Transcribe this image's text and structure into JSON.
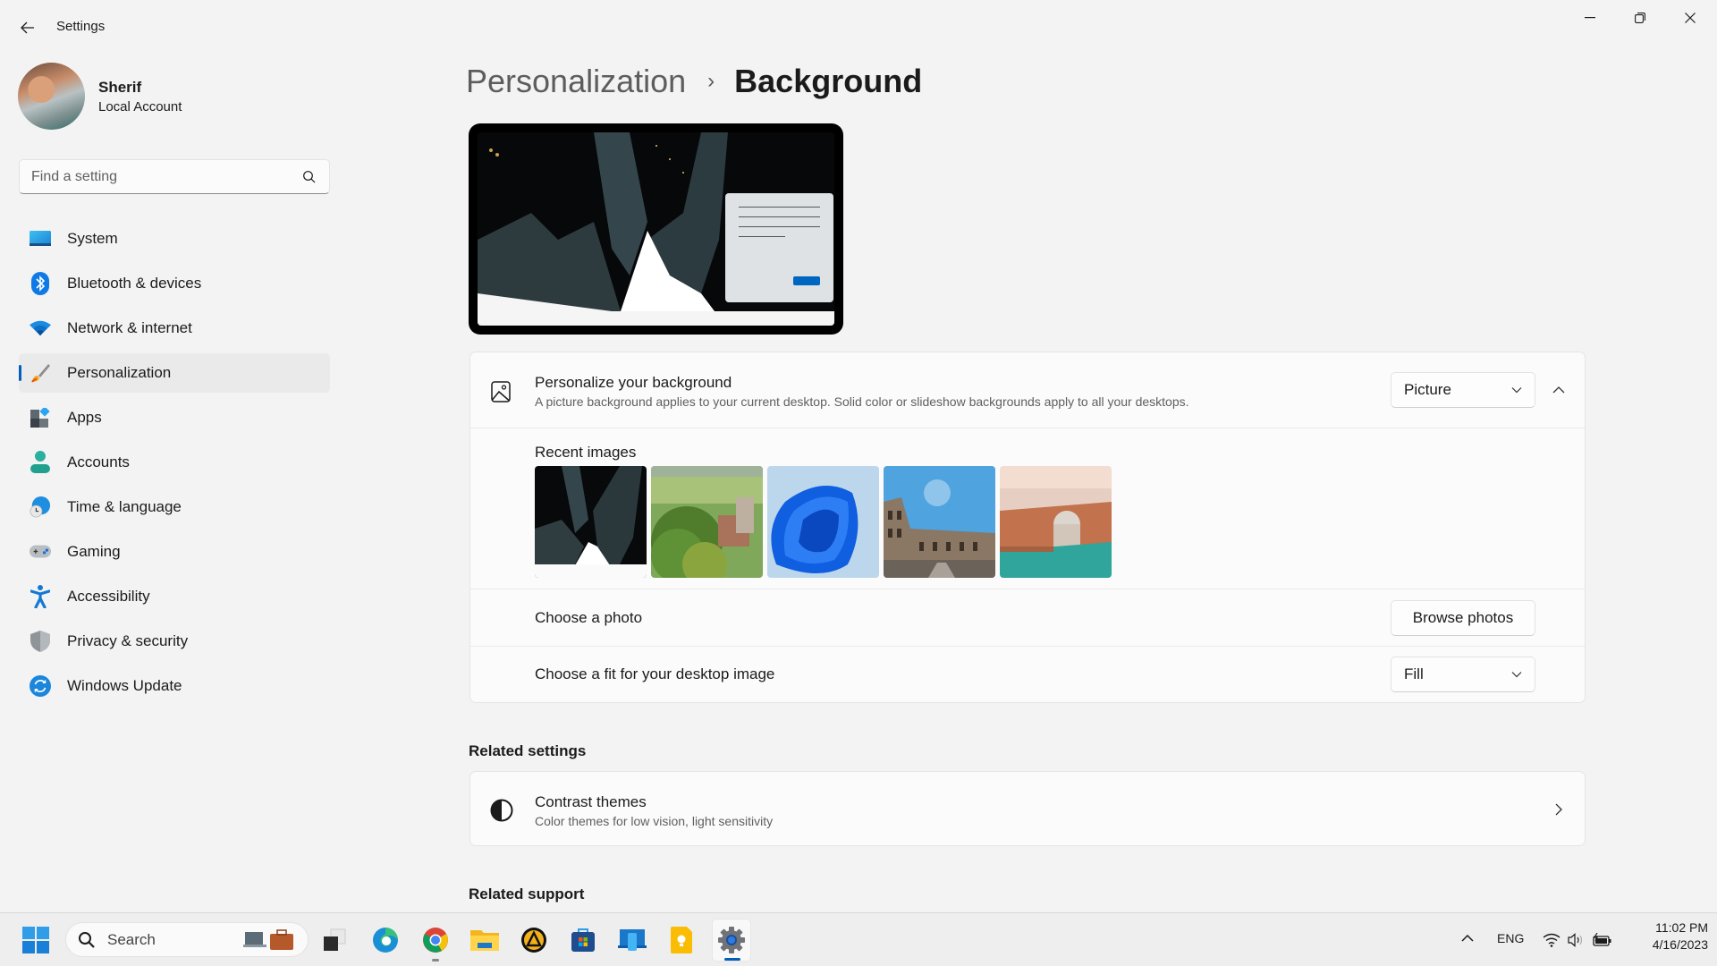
{
  "window": {
    "title": "Settings",
    "controls": {
      "minimize": "minimize-icon",
      "restore": "restore-icon",
      "close": "close-icon"
    }
  },
  "user": {
    "name": "Sherif",
    "account_type": "Local Account"
  },
  "search": {
    "placeholder": "Find a setting",
    "value": ""
  },
  "sidebar": {
    "items": [
      {
        "label": "System",
        "icon": "system-icon",
        "selected": false
      },
      {
        "label": "Bluetooth & devices",
        "icon": "bluetooth-icon",
        "selected": false
      },
      {
        "label": "Network & internet",
        "icon": "wifi-icon",
        "selected": false
      },
      {
        "label": "Personalization",
        "icon": "paintbrush-icon",
        "selected": true
      },
      {
        "label": "Apps",
        "icon": "apps-icon",
        "selected": false
      },
      {
        "label": "Accounts",
        "icon": "person-icon",
        "selected": false
      },
      {
        "label": "Time & language",
        "icon": "globe-clock-icon",
        "selected": false
      },
      {
        "label": "Gaming",
        "icon": "gamepad-icon",
        "selected": false
      },
      {
        "label": "Accessibility",
        "icon": "accessibility-icon",
        "selected": false
      },
      {
        "label": "Privacy & security",
        "icon": "shield-icon",
        "selected": false
      },
      {
        "label": "Windows Update",
        "icon": "update-icon",
        "selected": false
      }
    ]
  },
  "breadcrumb": {
    "parent": "Personalization",
    "separator": "›",
    "current": "Background"
  },
  "background_card": {
    "title": "Personalize your background",
    "description": "A picture background applies to your current desktop. Solid color or slideshow backgrounds apply to all your desktops.",
    "type_value": "Picture",
    "recent_images_label": "Recent images",
    "recent_images": [
      {
        "name": "dark-skyscrapers"
      },
      {
        "name": "green-countryside"
      },
      {
        "name": "windows-11-bloom"
      },
      {
        "name": "colosseum"
      },
      {
        "name": "venice-aerial"
      }
    ],
    "choose_photo_label": "Choose a photo",
    "browse_label": "Browse photos",
    "fit_label": "Choose a fit for your desktop image",
    "fit_value": "Fill"
  },
  "related_settings": {
    "heading": "Related settings",
    "items": [
      {
        "title": "Contrast themes",
        "subtitle": "Color themes for low vision, light sensitivity"
      }
    ]
  },
  "related_support": {
    "heading": "Related support"
  },
  "taskbar": {
    "search_label": "Search",
    "apps": [
      "task-view",
      "edge",
      "chrome",
      "file-explorer",
      "aimp",
      "microsoft-store",
      "phone-link",
      "keep",
      "settings"
    ],
    "active_app": "settings",
    "language": "ENG",
    "time": "11:02 PM",
    "date": "4/16/2023"
  },
  "colors": {
    "accent": "#005fb8",
    "background": "#f3f3f3",
    "card": "#fbfbfb"
  }
}
